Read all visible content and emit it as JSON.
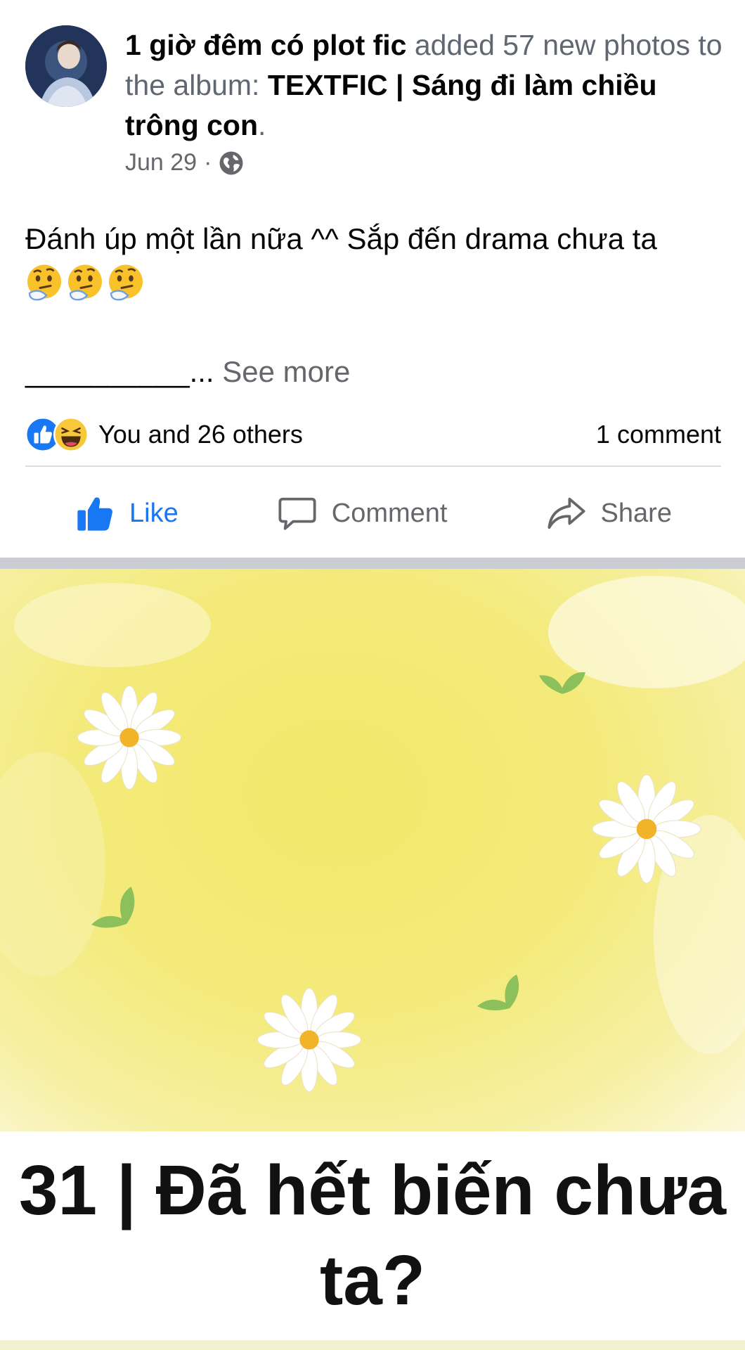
{
  "post": {
    "author": "1 giờ đêm có plot fic",
    "action_text": " added 57 new photos to the album: ",
    "album": "TEXTFIC | Sáng đi làm chiều trông con",
    "album_suffix": ".",
    "date": "Jun 29",
    "separator": "·",
    "privacy_icon": "globe-icon",
    "body_text": "Đánh úp một lần nữa ^^ Sắp đến drama chưa ta",
    "body_emojis": [
      "thinking-face-emoji",
      "thinking-face-emoji",
      "thinking-face-emoji"
    ],
    "truncated_line": "__________...",
    "see_more": " See more"
  },
  "reactions": {
    "icons": [
      "like-reaction-icon",
      "haha-reaction-icon"
    ],
    "summary": "You and 26 others",
    "comments": "1 comment"
  },
  "actions": {
    "like": "Like",
    "comment": "Comment",
    "share": "Share"
  },
  "photo": {
    "caption": "31 | Đã hết biến chưa ta?"
  },
  "colors": {
    "like_blue": "#1877f2",
    "muted_text": "#65676b",
    "photo_yellow": "#f2e86a",
    "leaf_green": "#8cc05a"
  }
}
